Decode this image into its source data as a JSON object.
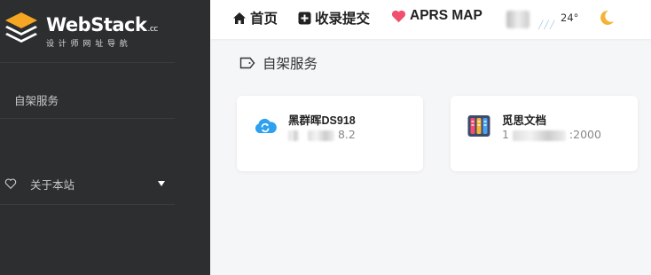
{
  "sidebar": {
    "logo_text": "WebStack",
    "logo_suffix": ".cc",
    "logo_subtitle": "设计师网址导航",
    "items": [
      {
        "label": "自架服务"
      },
      {
        "label": "关于本站"
      }
    ]
  },
  "header": {
    "nav": [
      {
        "label": "首页",
        "icon": "home-icon"
      },
      {
        "label": "收录提交",
        "icon": "plus-square-icon"
      },
      {
        "label": "APRS MAP",
        "icon": "heart-icon"
      }
    ],
    "weather_temp": "24°",
    "theme_icon": "moon-icon"
  },
  "main": {
    "section_title": "自架服务",
    "cards": [
      {
        "title": "黑群晖DS918",
        "desc_suffix": "8.2",
        "icon": "cloud-sync-icon"
      },
      {
        "title": "觅思文档",
        "desc_prefix": "1",
        "desc_suffix": ":2000",
        "icon": "document-columns-icon"
      }
    ]
  },
  "colors": {
    "sidebar_bg": "#2c2e2f",
    "accent_heart": "#f0506e",
    "moon": "#f5b335",
    "cloud_blue": "#2ea0f0"
  }
}
